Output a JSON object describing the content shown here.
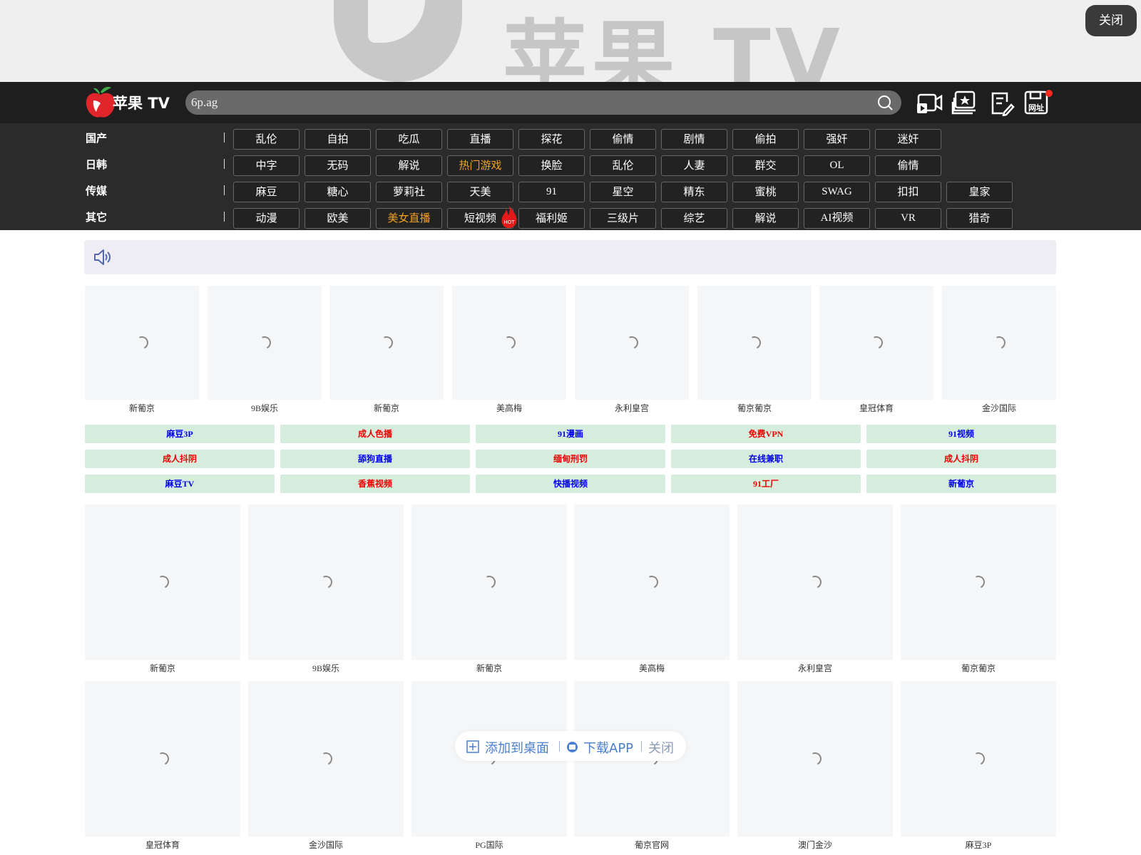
{
  "banner": {
    "watermark_text": "苹果 TV",
    "close_label": "关闭"
  },
  "header": {
    "logo_text": "苹果 TV",
    "search_value": "6p.ag",
    "icons": [
      "video-camera-icon",
      "star-album-icon",
      "edit-note-icon",
      "save-url-icon"
    ],
    "save_url_label": "网址"
  },
  "categories": [
    {
      "label": "国产",
      "items": [
        "乱伦",
        "自拍",
        "吃瓜",
        "直播",
        "探花",
        "偷情",
        "剧情",
        "偷拍",
        "强奸",
        "迷奸"
      ]
    },
    {
      "label": "日韩",
      "items": [
        "中字",
        "无码",
        "解说",
        "热门游戏",
        "换脸",
        "乱伦",
        "人妻",
        "群交",
        "OL",
        "偷情"
      ]
    },
    {
      "label": "传媒",
      "items": [
        "麻豆",
        "糖心",
        "萝莉社",
        "天美",
        "91",
        "星空",
        "精东",
        "蜜桃",
        "SWAG",
        "扣扣",
        "皇家"
      ]
    },
    {
      "label": "其它",
      "items": [
        "动漫",
        "欧美",
        "美女直播",
        "短视频",
        "福利姬",
        "三级片",
        "综艺",
        "解说",
        "AI视频",
        "VR",
        "猎奇"
      ]
    }
  ],
  "highlight_items": [
    "热门游戏",
    "美女直播"
  ],
  "hot_badge": "HOT",
  "row1_tiles": [
    "新葡京",
    "9B娱乐",
    "新葡京",
    "美高梅",
    "永利皇宫",
    "葡京葡京",
    "皇冠体育",
    "金沙国际"
  ],
  "link_buttons": [
    {
      "label": "麻豆3P",
      "color": "#0000ee"
    },
    {
      "label": "成人色播",
      "color": "#ee0000"
    },
    {
      "label": "91漫画",
      "color": "#0000ee"
    },
    {
      "label": "免费VPN",
      "color": "#ee0000"
    },
    {
      "label": "91视频",
      "color": "#0000ee"
    },
    {
      "label": "成人抖阴",
      "color": "#ee0000"
    },
    {
      "label": "舔狗直播",
      "color": "#0000ee"
    },
    {
      "label": "缅甸刑罚",
      "color": "#ee0000"
    },
    {
      "label": "在线兼职",
      "color": "#0000ee"
    },
    {
      "label": "成人抖阴",
      "color": "#ee0000"
    },
    {
      "label": "麻豆TV",
      "color": "#0000ee"
    },
    {
      "label": "香蕉视频",
      "color": "#ee0000"
    },
    {
      "label": "快播视频",
      "color": "#0000ee"
    },
    {
      "label": "91工厂",
      "color": "#ee0000"
    },
    {
      "label": "新葡京",
      "color": "#0000ee"
    }
  ],
  "row2_tiles": [
    "新葡京",
    "9B娱乐",
    "新葡京",
    "美高梅",
    "永利皇宫",
    "葡京葡京"
  ],
  "row3_tiles": [
    "皇冠体育",
    "金沙国际",
    "PG国际",
    "葡京官网",
    "澳门金沙",
    "麻豆3P"
  ],
  "float_bar": {
    "add_desktop": "添加到桌面",
    "download_app": "下载APP",
    "close": "关闭"
  }
}
